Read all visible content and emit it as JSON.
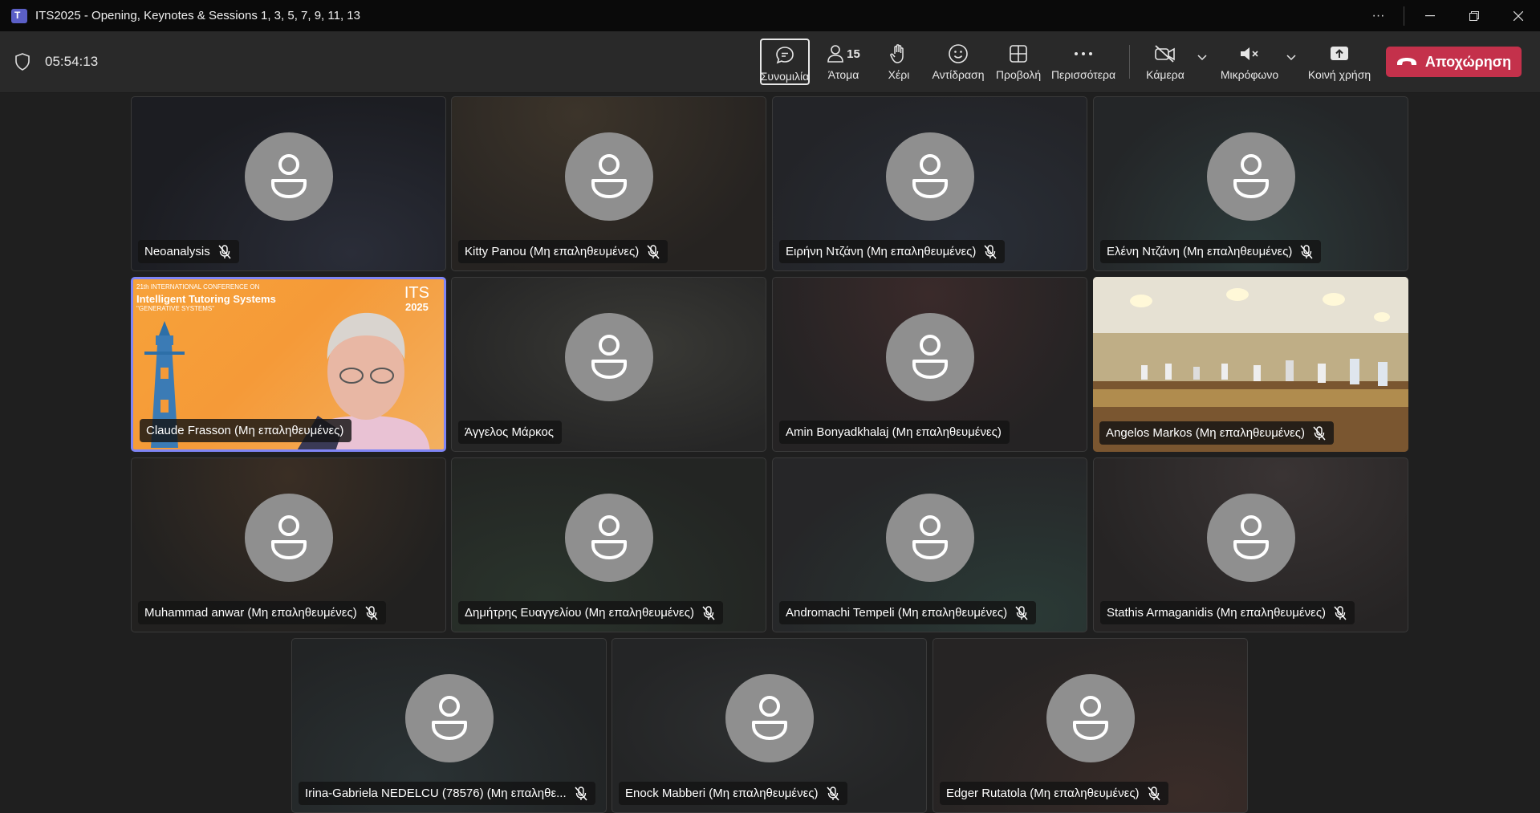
{
  "window": {
    "title": "ITS2025 - Opening, Keynotes & Sessions 1, 3, 5, 7, 9, 11, 13",
    "more_icon": "ellipsis-icon"
  },
  "toolbar": {
    "timer": "05:54:13",
    "chat_label": "Συνομιλία",
    "people_label": "Άτομα",
    "people_count": "15",
    "raise_hand_label": "Χέρι",
    "react_label": "Αντίδραση",
    "view_label": "Προβολή",
    "more_label": "Περισσότερα",
    "camera_label": "Κάμερα",
    "mic_label": "Μικρόφωνο",
    "share_label": "Κοινή χρήση",
    "leave_label": "Αποχώρηση",
    "leave_color": "#c4314b"
  },
  "speaker_slide": {
    "line1": "21th INTERNATIONAL CONFERENCE ON",
    "line2": "Intelligent Tutoring Systems",
    "line3": "\"GENERATIVE SYSTEMS\"",
    "logo_top": "ITS",
    "logo_year": "2025"
  },
  "participants": [
    {
      "name": "Neoanalysis"
    },
    {
      "name": "Kitty Panou (Μη επαληθευμένες)"
    },
    {
      "name": "Ειρήνη Ντζάνη (Μη επαληθευμένες)"
    },
    {
      "name": "Ελένη Ντζάνη (Μη επαληθευμένες)"
    },
    {
      "name": "Claude Frasson (Μη επαληθευμένες)"
    },
    {
      "name": "Άγγελος Μάρκος"
    },
    {
      "name": "Amin Bonyadkhalaj (Μη επαληθευμένες)"
    },
    {
      "name": "Angelos Markos (Μη επαληθευμένες)"
    },
    {
      "name": "Muhammad anwar (Μη επαληθευμένες)"
    },
    {
      "name": "Δημήτρης Ευαγγελίου (Μη επαληθευμένες)"
    },
    {
      "name": "Andromachi Tempeli (Μη επαληθευμένες)"
    },
    {
      "name": "Stathis Armaganidis (Μη επαληθευμένες)"
    },
    {
      "name": "Irina-Gabriela NEDELCU (78576) (Μη επαληθε..."
    },
    {
      "name": "Enock Mabberi (Μη επαληθευμένες)"
    },
    {
      "name": "Edger Rutatola (Μη επαληθευμένες)"
    }
  ]
}
